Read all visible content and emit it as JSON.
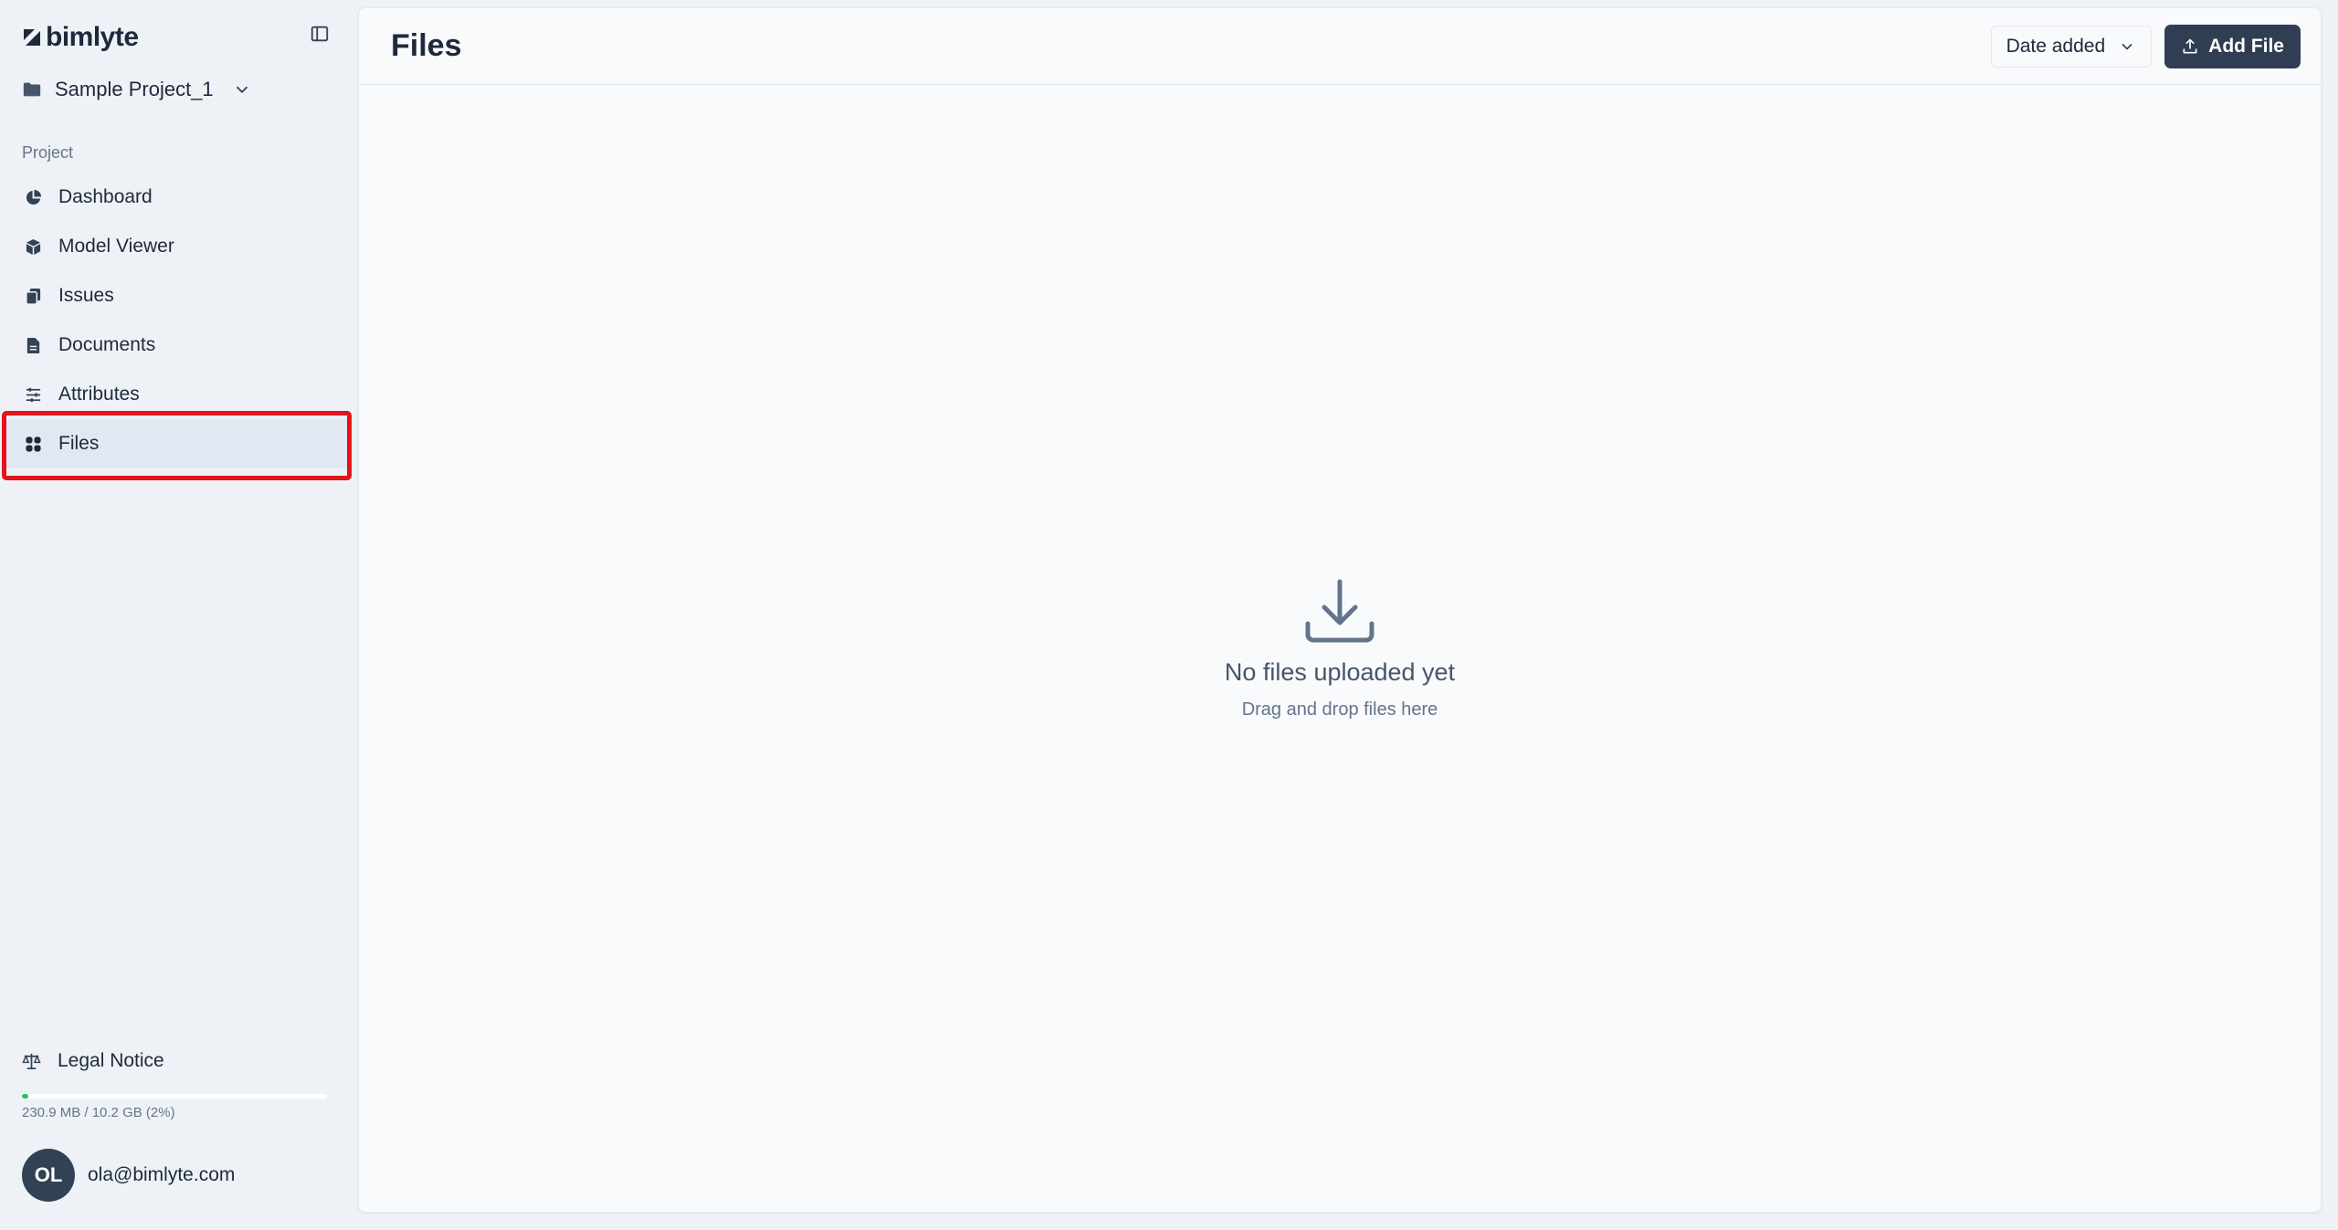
{
  "brand": {
    "name": "bimlyte"
  },
  "project": {
    "name": "Sample Project_1"
  },
  "sidebar": {
    "section_label": "Project",
    "items": [
      {
        "label": "Dashboard",
        "icon": "pie-chart-icon",
        "active": false
      },
      {
        "label": "Model Viewer",
        "icon": "cube-icon",
        "active": false
      },
      {
        "label": "Issues",
        "icon": "clipboard-icon",
        "active": false
      },
      {
        "label": "Documents",
        "icon": "document-icon",
        "active": false
      },
      {
        "label": "Attributes",
        "icon": "sliders-icon",
        "active": false
      },
      {
        "label": "Files",
        "icon": "grid-icon",
        "active": true
      }
    ],
    "legal_label": "Legal Notice",
    "storage": {
      "text": "230.9 MB / 10.2 GB (2%)",
      "fraction": 0.02
    },
    "user": {
      "initials": "OL",
      "email": "ola@bimlyte.com"
    }
  },
  "header": {
    "title": "Files",
    "sort_label": "Date added",
    "add_button_label": "Add File"
  },
  "empty_state": {
    "title": "No files uploaded yet",
    "subtitle": "Drag and drop files here"
  },
  "colors": {
    "primary": "#2f3e52",
    "highlight": "#e3131b",
    "storage_fill": "#22c55e"
  }
}
